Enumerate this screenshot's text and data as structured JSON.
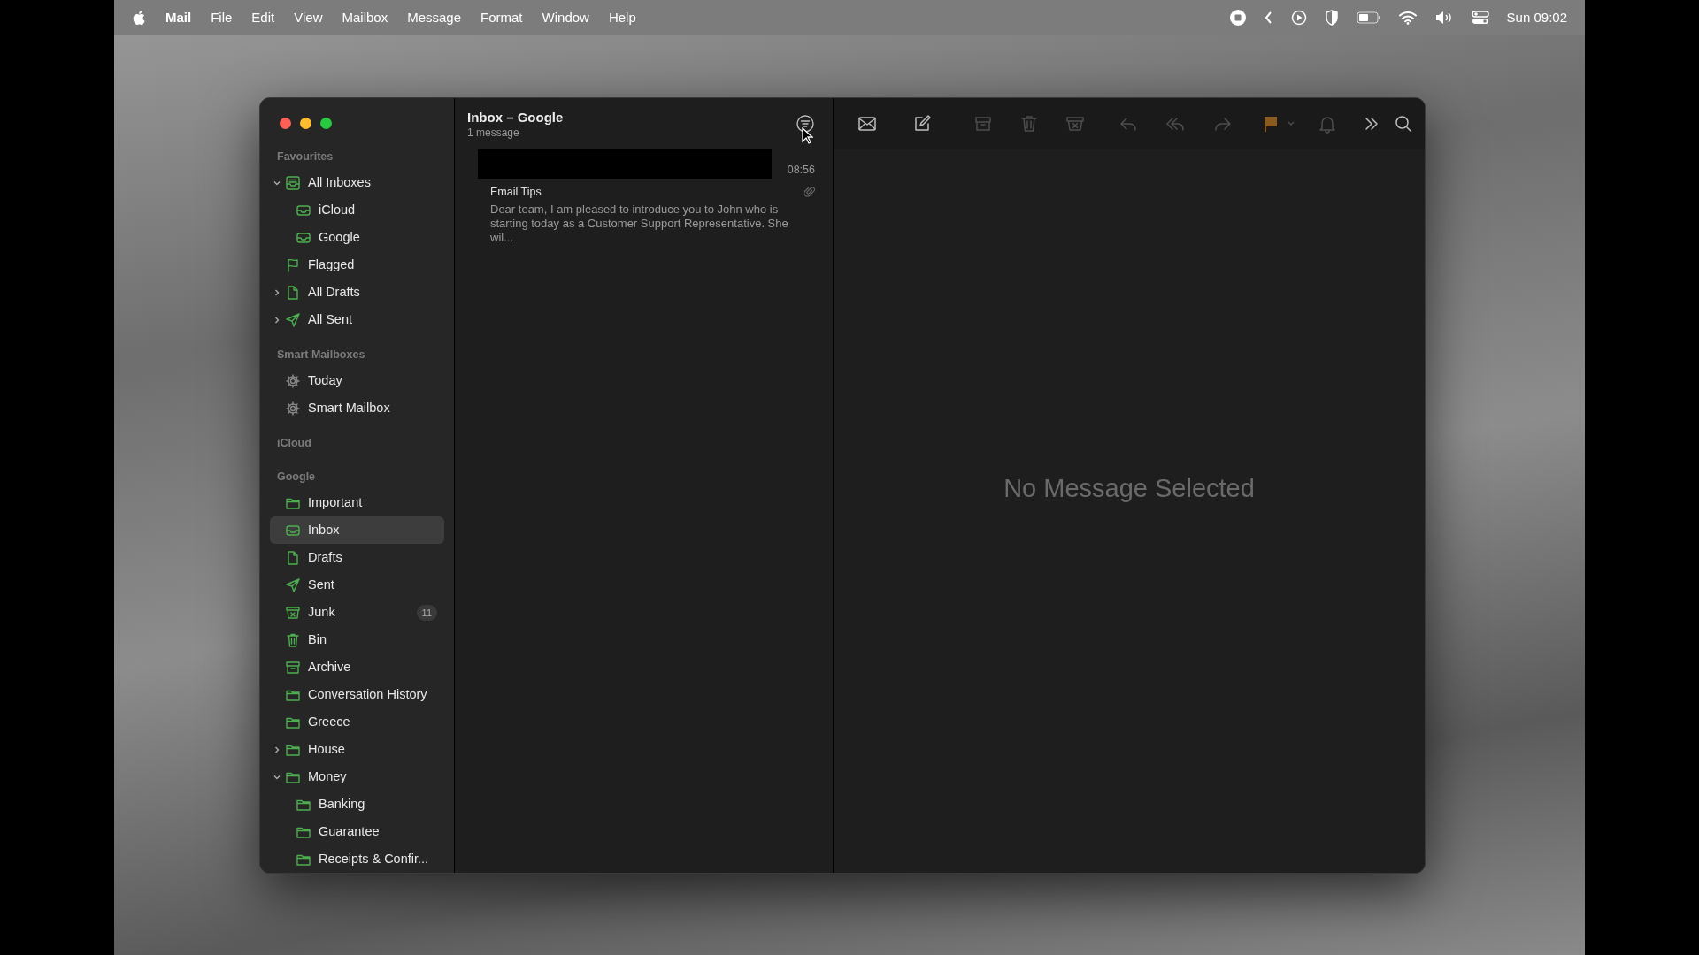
{
  "menubar": {
    "items": [
      {
        "label": "Mail",
        "kind": "app"
      },
      {
        "label": "File",
        "kind": "menu"
      },
      {
        "label": "Edit",
        "kind": "menu"
      },
      {
        "label": "View",
        "kind": "menu"
      },
      {
        "label": "Mailbox",
        "kind": "menu"
      },
      {
        "label": "Message",
        "kind": "menu"
      },
      {
        "label": "Format",
        "kind": "menu"
      },
      {
        "label": "Window",
        "kind": "menu"
      },
      {
        "label": "Help",
        "kind": "menu"
      }
    ],
    "clock": "Sun 09:02"
  },
  "sidebar": {
    "sections": [
      {
        "title": "Favourites",
        "items": [
          {
            "label": "All Inboxes",
            "kind": "inboxes",
            "expanded": true,
            "selected": false,
            "children": [
              {
                "label": "iCloud",
                "kind": "inbox",
                "selected": false
              },
              {
                "label": "Google",
                "kind": "inbox",
                "selected": false
              }
            ]
          },
          {
            "label": "Flagged",
            "kind": "flag",
            "selected": false
          },
          {
            "label": "All Drafts",
            "kind": "draft",
            "expanded": false,
            "selected": false
          },
          {
            "label": "All Sent",
            "kind": "sent",
            "expanded": false,
            "selected": false
          }
        ]
      },
      {
        "title": "Smart Mailboxes",
        "items": [
          {
            "label": "Today",
            "kind": "smart",
            "selected": false
          },
          {
            "label": "Smart Mailbox",
            "kind": "smart",
            "selected": false
          }
        ]
      },
      {
        "title": "iCloud"
      },
      {
        "title": "Google",
        "items": [
          {
            "label": "Important",
            "kind": "folder",
            "selected": false
          },
          {
            "label": "Inbox",
            "kind": "inbox",
            "selected": true
          },
          {
            "label": "Drafts",
            "kind": "draft",
            "selected": false
          },
          {
            "label": "Sent",
            "kind": "sent",
            "selected": false
          },
          {
            "label": "Junk",
            "kind": "junk",
            "selected": false,
            "badge": "11"
          },
          {
            "label": "Bin",
            "kind": "bin",
            "selected": false
          },
          {
            "label": "Archive",
            "kind": "archive",
            "selected": false
          },
          {
            "label": "Conversation History",
            "kind": "folder",
            "selected": false
          },
          {
            "label": "Greece",
            "kind": "folder",
            "selected": false
          },
          {
            "label": "House",
            "kind": "folder",
            "expanded": false,
            "selected": false
          },
          {
            "label": "Money",
            "kind": "folder",
            "expanded": true,
            "selected": false,
            "children": [
              {
                "label": "Banking",
                "kind": "folder",
                "selected": false
              },
              {
                "label": "Guarantee",
                "kind": "folder",
                "selected": false
              },
              {
                "label": "Receipts & Confir...",
                "kind": "folder",
                "selected": false
              }
            ]
          }
        ]
      }
    ]
  },
  "message_list": {
    "title": "Inbox – Google",
    "subtitle": "1 message",
    "messages": [
      {
        "sender_redacted": true,
        "time": "08:56",
        "subject": "Email Tips",
        "preview": "Dear team, I am pleased to introduce you to John who is starting today as a Customer Support Representative. She wil...",
        "attachment": true,
        "selected": false
      }
    ]
  },
  "toolbar": {
    "buttons": [
      {
        "kind": "envelope",
        "disabled": false
      },
      {
        "kind": "compose",
        "disabled": false
      },
      {
        "kind": "archive",
        "disabled": true
      },
      {
        "kind": "trash",
        "disabled": true
      },
      {
        "kind": "junk",
        "disabled": true
      },
      {
        "kind": "reply",
        "disabled": true
      },
      {
        "kind": "reply-all",
        "disabled": true
      },
      {
        "kind": "forward",
        "disabled": true
      },
      {
        "kind": "flag",
        "disabled": true,
        "color": "#8a5a1e"
      },
      {
        "kind": "caret",
        "disabled": true
      },
      {
        "kind": "bell",
        "disabled": true
      },
      {
        "kind": "chevrons",
        "disabled": false
      },
      {
        "kind": "search",
        "disabled": false
      }
    ]
  },
  "detail": {
    "placeholder": "No Message Selected"
  }
}
